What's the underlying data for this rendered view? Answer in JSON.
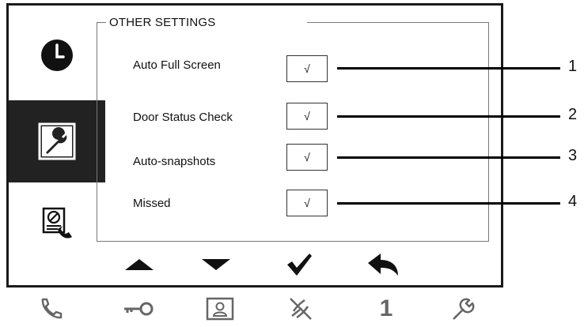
{
  "screen": {
    "group_title": "OTHER SETTINGS",
    "sidebar": {
      "items": [
        {
          "name": "clock",
          "icon": "clock-icon"
        },
        {
          "name": "settings",
          "icon": "wrench-icon",
          "selected": true
        },
        {
          "name": "log",
          "icon": "call-log-icon"
        }
      ]
    },
    "settings": [
      {
        "label": "Auto Full Screen",
        "checked_mark": "√"
      },
      {
        "label": "Door Status Check",
        "checked_mark": "√"
      },
      {
        "label": "Auto-snapshots",
        "checked_mark": "√"
      },
      {
        "label": "Missed",
        "checked_mark": "√"
      }
    ],
    "nav": [
      "up-arrow-icon",
      "down-arrow-icon",
      "check-icon",
      "back-icon"
    ]
  },
  "callouts": [
    "1",
    "2",
    "3",
    "4"
  ],
  "hardware_buttons": {
    "icons": [
      "phone-icon",
      "key-icon",
      "contact-card-icon",
      "mute-icon",
      "number-one",
      "wrench-icon"
    ],
    "number_label": "1"
  }
}
